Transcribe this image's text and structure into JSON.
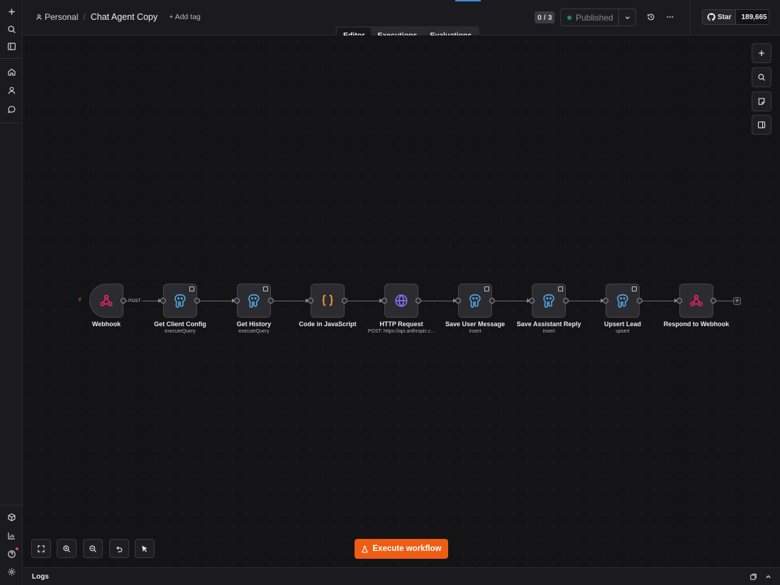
{
  "header": {
    "project": "Personal",
    "workflow_name": "Chat Agent Copy",
    "add_tag": "+ Add tag",
    "counter": "0 / 3",
    "publish_status": "Published",
    "github_star": "Star",
    "github_count": "189,665"
  },
  "tabs": [
    {
      "label": "Editor",
      "active": true
    },
    {
      "label": "Executions",
      "active": false
    },
    {
      "label": "Evaluations",
      "active": false
    }
  ],
  "workflow": {
    "connection_label": "POST",
    "nodes": [
      {
        "name": "Webhook",
        "subtitle": "",
        "icon": "webhook-icon"
      },
      {
        "name": "Get Client Config",
        "subtitle": "executeQuery",
        "icon": "postgres-icon"
      },
      {
        "name": "Get History",
        "subtitle": "executeQuery",
        "icon": "postgres-icon"
      },
      {
        "name": "Code in JavaScript",
        "subtitle": "",
        "icon": "code-braces-icon"
      },
      {
        "name": "HTTP Request",
        "subtitle": "POST: https://api.anthropic.c...",
        "icon": "globe-icon"
      },
      {
        "name": "Save User Message",
        "subtitle": "insert",
        "icon": "postgres-icon"
      },
      {
        "name": "Save Assistant Reply",
        "subtitle": "insert",
        "icon": "postgres-icon"
      },
      {
        "name": "Upsert Lead",
        "subtitle": "upsert",
        "icon": "postgres-icon"
      },
      {
        "name": "Respond to Webhook",
        "subtitle": "",
        "icon": "webhook-icon"
      }
    ]
  },
  "execute_button": "Execute workflow",
  "logs": {
    "title": "Logs"
  },
  "colors": {
    "accent": "#ee5d12",
    "webhook": "#e5245f",
    "postgres": "#4fa7e0",
    "code": "#f2a13a",
    "http": "#8b6cf0",
    "published_dot": "#1f8a6d"
  }
}
